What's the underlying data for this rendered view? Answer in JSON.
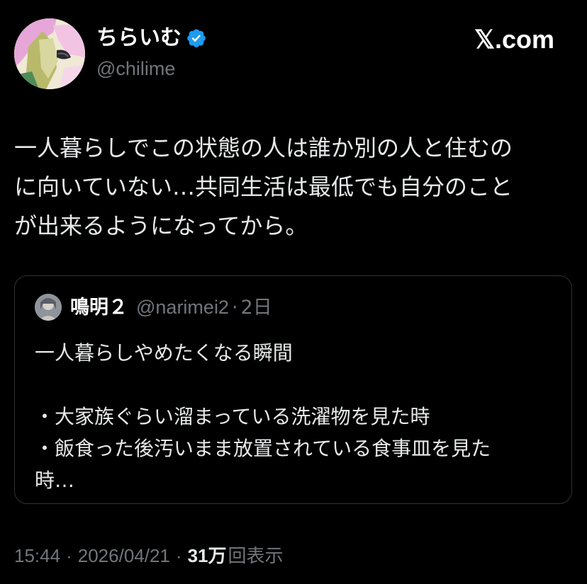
{
  "author": {
    "display_name": "ちらいむ",
    "handle": "@chilime",
    "verified": true
  },
  "brand": "𝕏.com",
  "tweet": {
    "lines": [
      "一人暮らしでこの状態の人は誰か別の人と住むの",
      "に向いていない…共同生活は最低でも自分のこと",
      "が出来るようになってから。"
    ]
  },
  "quote": {
    "display_name": "鳴明２",
    "handle": "@narimei2",
    "separator": "·",
    "time": "2日",
    "lines": [
      "一人暮らしやめたくなる瞬間",
      "",
      "・大家族ぐらい溜まっている洗濯物を見た時",
      "・飯食った後汚いまま放置されている食事皿を見た",
      "時…"
    ]
  },
  "meta": {
    "time": "15:44",
    "separator": "·",
    "date": "2026/04/21",
    "views_count": "31万",
    "views_label": "回表示"
  },
  "colors": {
    "background": "#000000",
    "text": "#e7e9ea",
    "secondary": "#71767b",
    "verified_badge": "#1d9bf0",
    "border": "#2f3336"
  },
  "icons": {
    "verified": "verified-badge-icon",
    "author_avatar": "anime-character-avatar",
    "quote_avatar": "person-avatar"
  }
}
